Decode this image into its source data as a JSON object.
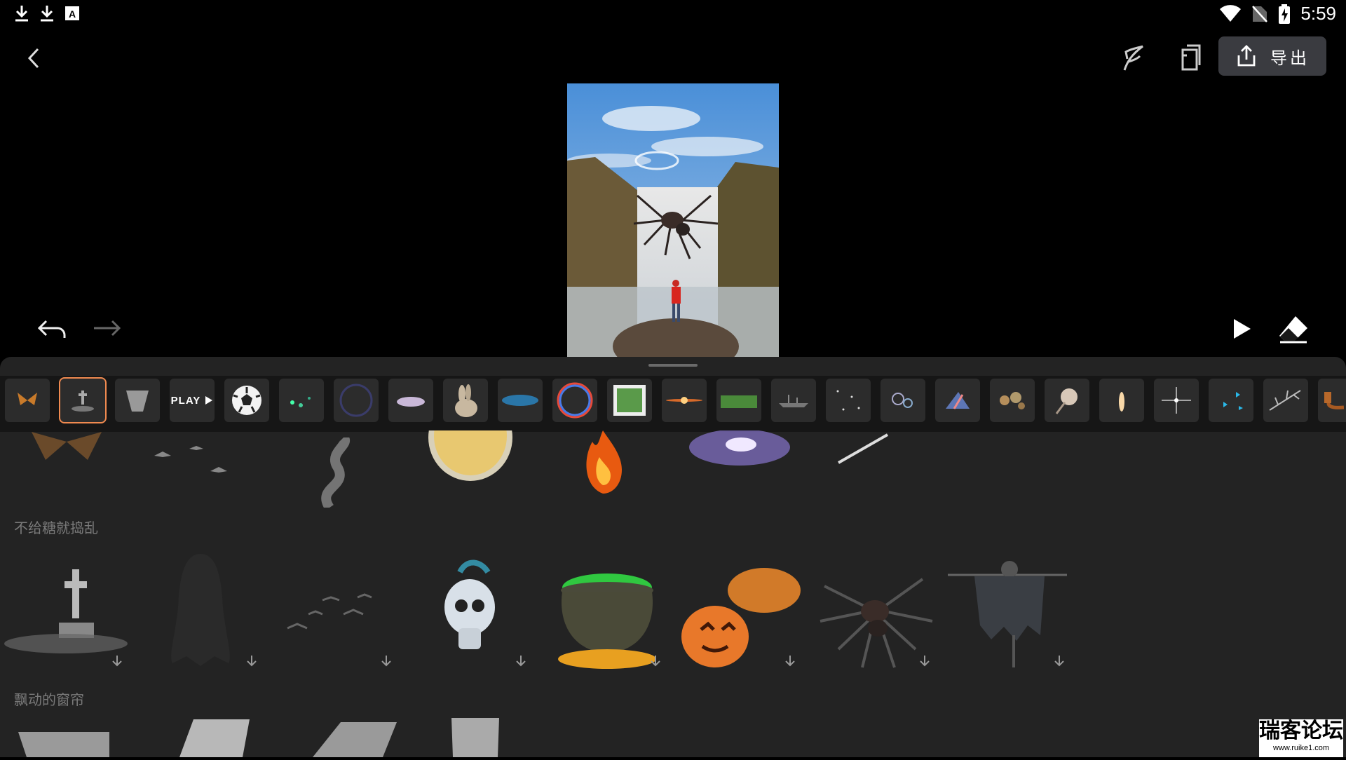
{
  "status_bar": {
    "time": "5:59",
    "left_icons": [
      "download-icon",
      "download-icon",
      "text-box-icon"
    ],
    "right_icons": [
      "wifi-icon",
      "no-sim-icon",
      "battery-charging-icon"
    ]
  },
  "toolbar": {
    "export_label": "导出",
    "icons": [
      "back-icon",
      "feather-icon",
      "layers-icon",
      "share-icon"
    ]
  },
  "strip_items": [
    "butterfly",
    "gravestone",
    "curtain",
    "play",
    "soccer-ball",
    "leaves",
    "dark-ring",
    "cloud",
    "rabbit",
    "blue-particles",
    "rainbow-ring",
    "window",
    "lens-flare",
    "grass",
    "ship",
    "stars",
    "bubbles",
    "prism",
    "bokeh",
    "dandelion",
    "candle",
    "sparkle",
    "blue-butterflies",
    "branch",
    "pipe"
  ],
  "strip_play_label": "PLAY",
  "sections": [
    {
      "title": "不给糖就捣乱",
      "items": [
        "gravestone",
        "ghost",
        "bats",
        "skull",
        "cauldron",
        "pumpkin",
        "spider",
        "scarecrow"
      ]
    },
    {
      "title": "飘动的窗帘",
      "items": [
        "lace-curtain",
        "white-curtain",
        "drape",
        "lace-panel"
      ]
    }
  ],
  "top_row_items": [
    "butterfly",
    "bats",
    "smoke",
    "coffee",
    "fire",
    "galaxy",
    "meteor"
  ],
  "watermark": {
    "main": "瑞客论坛",
    "sub": "www.ruike1.com"
  },
  "colors": {
    "selection": "#f08a50",
    "panel": "#232323",
    "export_bg": "#3a3b40"
  }
}
